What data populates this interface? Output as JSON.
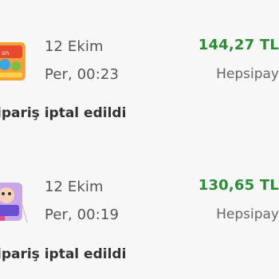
{
  "orders": [
    {
      "date": "12 Ekim",
      "time": "Per, 00:23",
      "amount": "144,27 TL",
      "payment_method": "Hepsipay",
      "status": "ipariş iptal edildi",
      "thumbnail_icon": "product-thumbnail-icon"
    },
    {
      "date": "12 Ekim",
      "time": "Per, 00:19",
      "amount": "130,65 TL",
      "payment_method": "Hepsipay",
      "status": "ipariş iptal edildi",
      "thumbnail_icon": "product-thumbnail-icon"
    }
  ],
  "colors": {
    "amount": "#2e8b3a",
    "text_secondary": "#555555",
    "status": "#333333",
    "background": "#f7f7f7"
  }
}
